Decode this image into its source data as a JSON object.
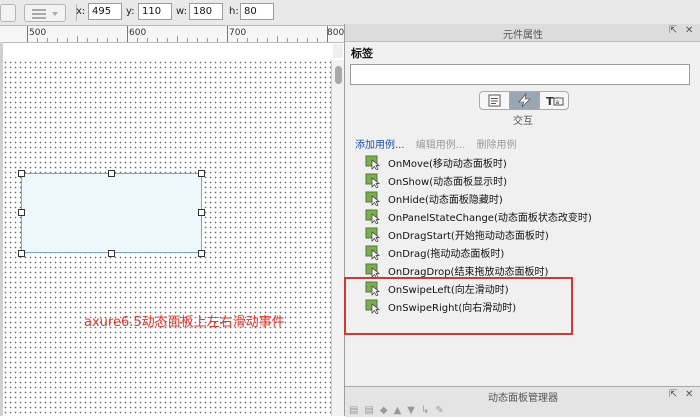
{
  "toolbar": {
    "x_label": "x:",
    "x_value": "495",
    "y_label": "y:",
    "y_value": "110",
    "w_label": "w:",
    "w_value": "180",
    "h_label": "h:",
    "h_value": "80"
  },
  "ruler": {
    "labels": [
      "500",
      "600",
      "700",
      "800"
    ]
  },
  "canvas": {
    "caption": "axure6.5动态面板上左右滑动事件"
  },
  "panel": {
    "title": "元件属性",
    "tag_label": "标签",
    "tag_value": "",
    "section_label": "交互",
    "add_case": "添加用例...",
    "edit_case": "编辑用例...",
    "delete_case": "删除用例",
    "events": [
      "OnMove(移动动态面板时)",
      "OnShow(动态面板显示时)",
      "OnHide(动态面板隐藏时)",
      "OnPanelStateChange(动态面板状态改变时)",
      "OnDragStart(开始拖动动态面板时)",
      "OnDrag(拖动动态面板时)",
      "OnDragDrop(结束拖放动态面板时)",
      "OnSwipeLeft(向左滑动时)",
      "OnSwipeRight(向右滑动时)"
    ],
    "tabs": [
      "notes-icon",
      "interactions-icon",
      "text-format-icon"
    ],
    "highlight_color": "#d43636"
  },
  "bottom_panel": {
    "title": "动态面板管理器"
  },
  "colors": {
    "link": "#1f4fa8",
    "caption": "#e8342b",
    "active_tab": "#9aa6b2"
  }
}
